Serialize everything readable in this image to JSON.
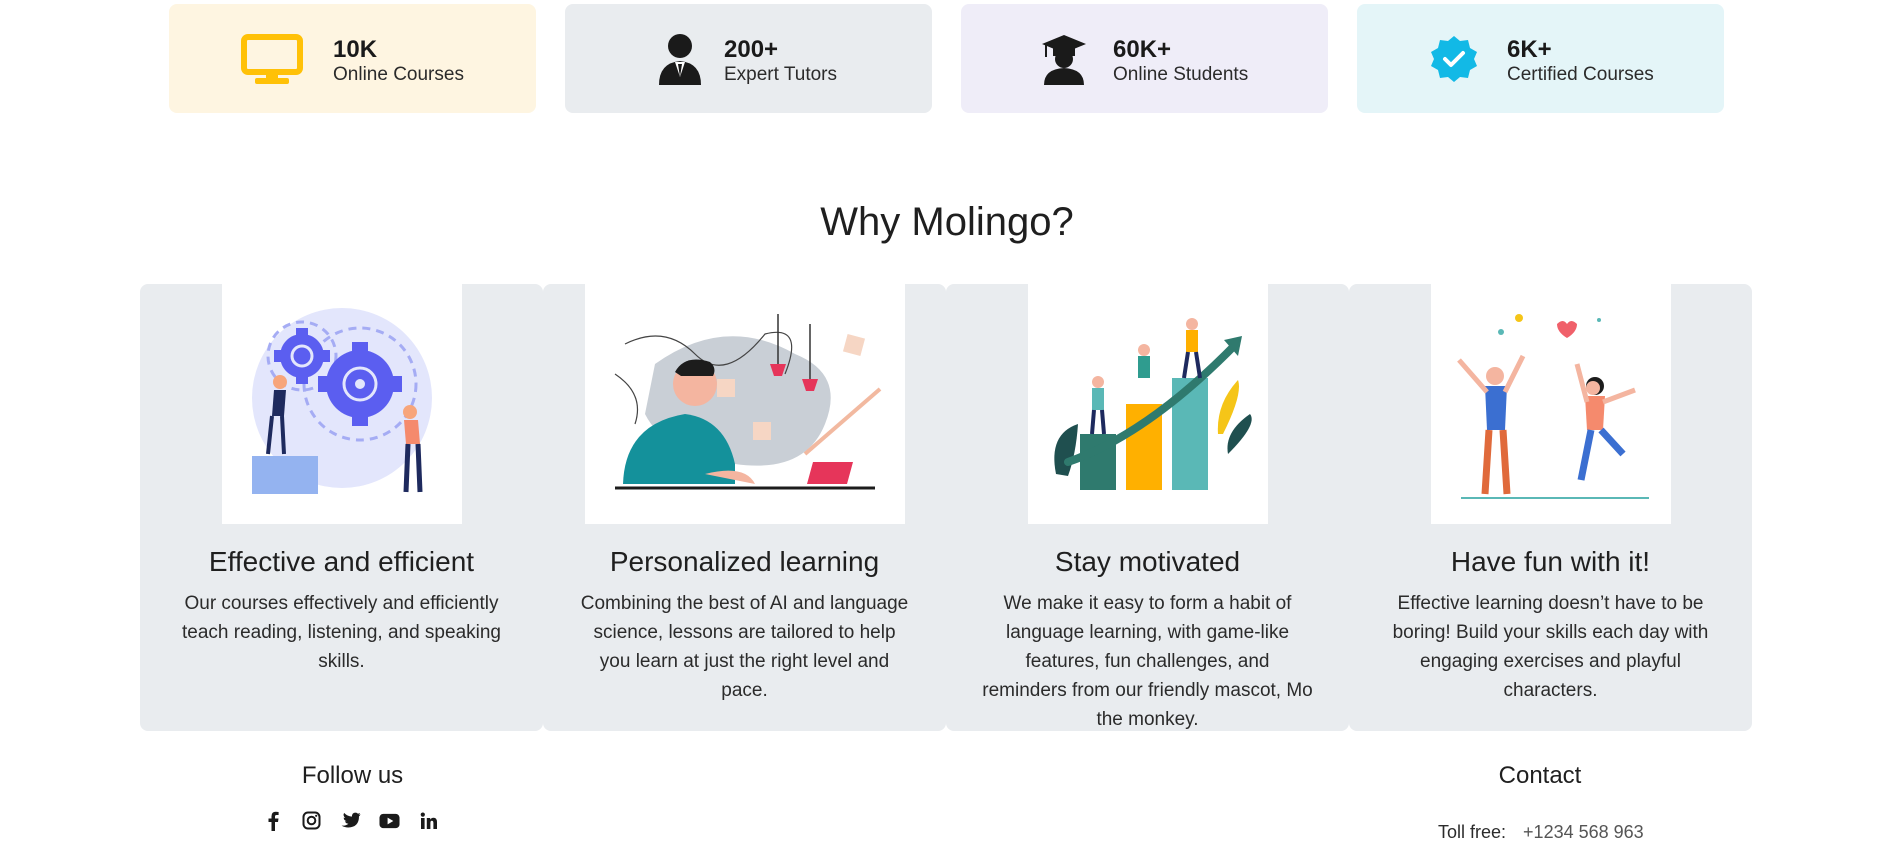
{
  "stats": [
    {
      "value": "10K",
      "label": "Online Courses",
      "icon": "monitor-icon",
      "bg": "#fef5e1",
      "icon_color": "#ffc107"
    },
    {
      "value": "200+",
      "label": "Expert Tutors",
      "icon": "tutor-icon",
      "bg": "#e9ecef",
      "icon_color": "#1a1a1a"
    },
    {
      "value": "60K+",
      "label": "Online Students",
      "icon": "graduate-icon",
      "bg": "#efedf8",
      "icon_color": "#1a1a1a"
    },
    {
      "value": "6K+",
      "label": "Certified Courses",
      "icon": "verified-badge-icon",
      "bg": "#e4f5f8",
      "icon_color": "#12b9e6"
    }
  ],
  "why": {
    "title": "Why Molingo?",
    "features": [
      {
        "title": "Effective and efficient",
        "text": "Our courses effectively and efficiently teach reading, listening, and speaking skills.",
        "illustration": "gears-teamwork-illustration"
      },
      {
        "title": "Personalized learning",
        "text": "Combining the best of AI and language science, lessons are tailored to help you learn at just the right level and pace.",
        "illustration": "student-studying-illustration"
      },
      {
        "title": "Stay motivated",
        "text": "We make it easy to form a habit of language learning, with game-like features, fun challenges, and reminders from our friendly mascot, Mo the monkey.",
        "illustration": "growth-chart-illustration"
      },
      {
        "title": "Have fun with it!",
        "text": "Effective learning doesn’t have to be boring! Build your skills each day with engaging exercises and playful characters.",
        "illustration": "celebrating-people-illustration"
      }
    ]
  },
  "footer": {
    "follow_title": "Follow us",
    "socials": [
      "facebook-icon",
      "instagram-icon",
      "twitter-icon",
      "youtube-icon",
      "linkedin-icon"
    ],
    "contact_title": "Contact",
    "toll_free_label": "Toll free:",
    "toll_free_number": "+1234 568 963"
  }
}
